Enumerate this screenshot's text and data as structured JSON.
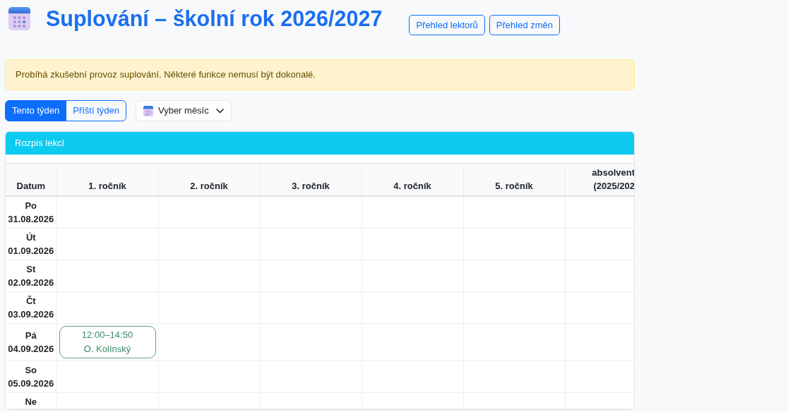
{
  "header": {
    "title": "Suplování – školní rok 2026/2027",
    "buttons": [
      {
        "label": "Přehled lektorů"
      },
      {
        "label": "Přehled změn"
      }
    ]
  },
  "alert": {
    "text": "Probíhá zkušební provoz suplování. Některé funkce nemusí být dokonalé."
  },
  "week_tabs": [
    {
      "label": "Tento týden",
      "selected": true
    },
    {
      "label": "Příští týden",
      "selected": false
    }
  ],
  "month_dropdown": {
    "label": "Vyber měsíc"
  },
  "schedule": {
    "title": "Rozpis lekcí",
    "columns": [
      "Datum",
      "1. ročník",
      "2. ročník",
      "3. ročník",
      "4. ročník",
      "5. ročník",
      "absolvent (2025/202"
    ],
    "rows": [
      {
        "day": "Po",
        "date": "31.08.2026"
      },
      {
        "day": "Út",
        "date": "01.09.2026"
      },
      {
        "day": "St",
        "date": "02.09.2026"
      },
      {
        "day": "Čt",
        "date": "03.09.2026"
      },
      {
        "day": "Pá",
        "date": "04.09.2026",
        "cells": [
          {
            "lessons": [
              {
                "time": "12:00–14:50",
                "teacher": "O. Kolínský"
              }
            ]
          }
        ]
      },
      {
        "day": "So",
        "date": "05.09.2026"
      },
      {
        "day": "Ne"
      }
    ]
  }
}
